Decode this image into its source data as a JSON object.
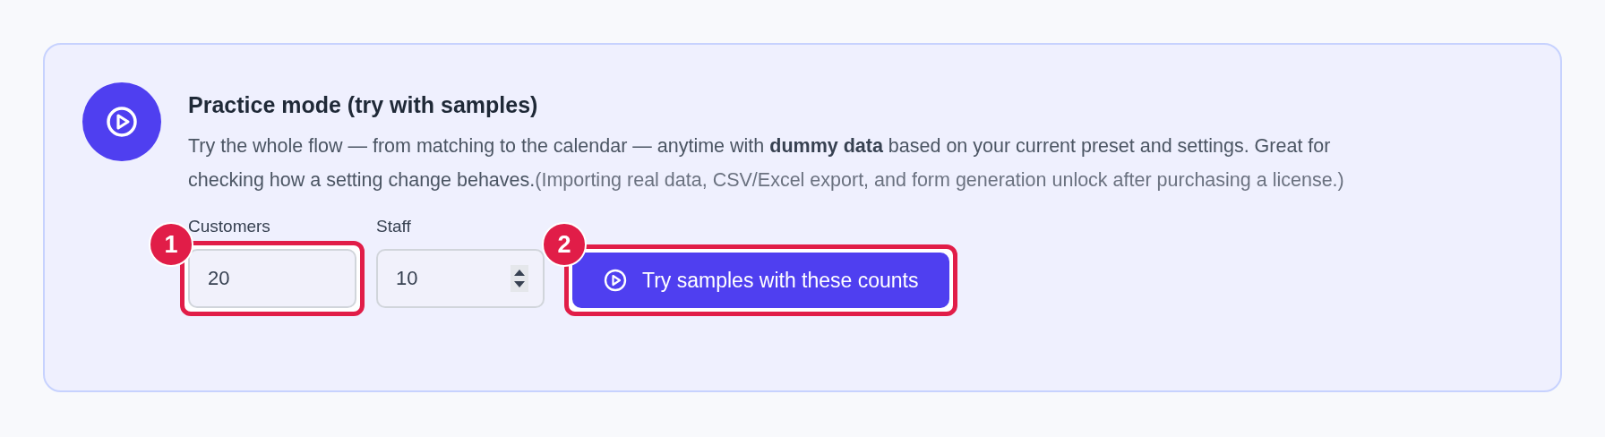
{
  "practice_card": {
    "title": "Practice mode (try with samples)",
    "description": "Try the whole flow — from matching to the calendar — anytime with **dummy data** based on your current preset and settings. Great for checking how a setting change behaves.",
    "note": "(Importing real data, CSV/Excel export, and form generation unlock after purchasing a license.)",
    "fields": [
      {
        "label": "Customers",
        "value": "20",
        "kind": "text",
        "annotation": "1"
      },
      {
        "label": "Staff",
        "value": "10",
        "kind": "number"
      }
    ],
    "button": {
      "label": "Try samples with these counts",
      "annotation": "2"
    }
  }
}
